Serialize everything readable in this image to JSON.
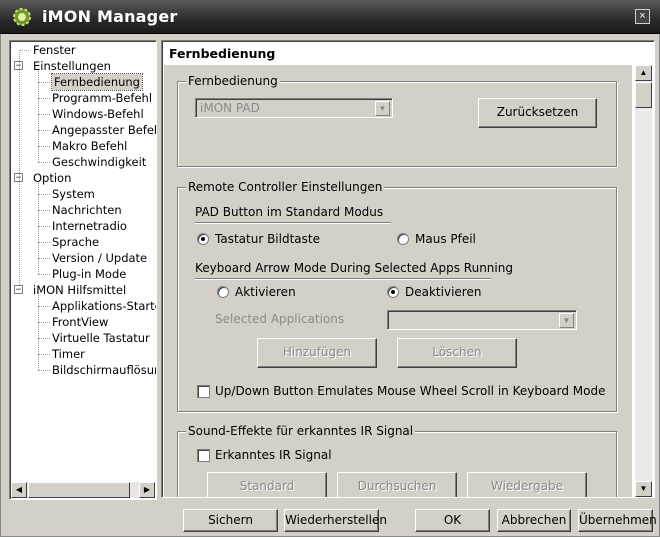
{
  "window": {
    "title": "iMON Manager",
    "icon": "imon-gear-icon",
    "close": "×"
  },
  "tree": {
    "items": [
      {
        "label": "Fenster",
        "level": 0
      },
      {
        "label": "Einstellungen",
        "level": 0,
        "toggle": "−"
      },
      {
        "label": "Fernbedienung",
        "level": 1,
        "selected": true
      },
      {
        "label": "Programm-Befehl",
        "level": 1
      },
      {
        "label": "Windows-Befehl",
        "level": 1
      },
      {
        "label": "Angepasster Befehl",
        "level": 1
      },
      {
        "label": "Makro  Befehl",
        "level": 1
      },
      {
        "label": "Geschwindigkeit",
        "level": 1
      },
      {
        "label": "Option",
        "level": 0,
        "toggle": "−"
      },
      {
        "label": "System",
        "level": 1
      },
      {
        "label": "Nachrichten",
        "level": 1
      },
      {
        "label": "Internetradio",
        "level": 1
      },
      {
        "label": "Sprache",
        "level": 1
      },
      {
        "label": "Version / Update",
        "level": 1
      },
      {
        "label": "Plug-in Mode",
        "level": 1
      },
      {
        "label": "iMON Hilfsmittel",
        "level": 0,
        "toggle": "−"
      },
      {
        "label": "Applikations-Starter",
        "level": 1
      },
      {
        "label": "FrontView",
        "level": 1
      },
      {
        "label": "Virtuelle Tastatur",
        "level": 1
      },
      {
        "label": "Timer",
        "level": 1
      },
      {
        "label": "Bildschirmauflösung",
        "level": 1
      }
    ]
  },
  "panel": {
    "header": "Fernbedienung",
    "group_remote": {
      "legend": "Fernbedienung",
      "device_select": "iMON PAD",
      "reset_button": "Zurücksetzen"
    },
    "group_controller": {
      "legend": "Remote Controller Einstellungen",
      "pad_section": "PAD Button im Standard Modus",
      "radio_keyboard": "Tastatur Bildtaste",
      "radio_mouse": "Maus Pfeil",
      "arrow_section": "Keyboard Arrow Mode During Selected Apps Running",
      "radio_enable": "Aktivieren",
      "radio_disable": "Deaktivieren",
      "selected_apps_label": "Selected Applications",
      "selected_apps_value": "",
      "add_button": "Hinzufügen",
      "delete_button": "Löschen",
      "wheel_checkbox": "Up/Down Button Emulates Mouse Wheel Scroll in Keyboard Mode"
    },
    "group_sound": {
      "legend": "Sound-Effekte für erkanntes IR Signal",
      "ir_checkbox": "Erkanntes IR Signal",
      "standard_button": "Standard",
      "browse_button": "Durchsuchen",
      "play_button": "Wiedergabe"
    }
  },
  "footer": {
    "save": "Sichern",
    "restore": "Wiederherstellen",
    "ok": "OK",
    "cancel": "Abbrechen",
    "apply": "Übernehmen"
  },
  "colors": {
    "face": "#d4d0c8",
    "titlebar": "#2a2a2a",
    "disabled_text": "#8a8a8a"
  }
}
